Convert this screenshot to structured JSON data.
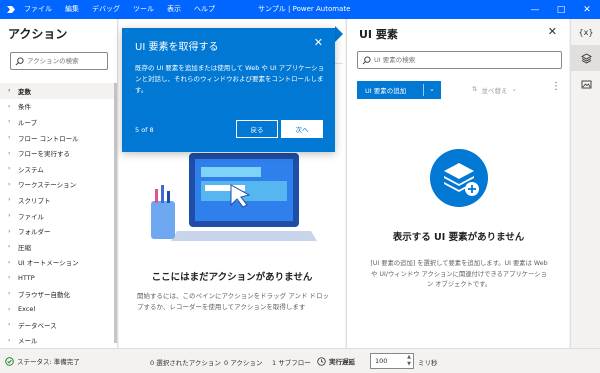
{
  "titlebar": {
    "menu": [
      "ファイル",
      "編集",
      "デバッグ",
      "ツール",
      "表示",
      "ヘルプ"
    ],
    "title": "サンプル | Power Automate",
    "accent": "#0066ff"
  },
  "actions": {
    "title": "アクション",
    "search_placeholder": "アクションの検索",
    "items": [
      "変数",
      "条件",
      "ループ",
      "フロー コントロール",
      "フローを実行する",
      "システム",
      "ワークステーション",
      "スクリプト",
      "ファイル",
      "フォルダー",
      "圧縮",
      "UI オートメーション",
      "HTTP",
      "ブラウザー自動化",
      "Excel",
      "データベース",
      "メール"
    ]
  },
  "center": {
    "empty_title": "ここにはまだアクションがありません",
    "empty_desc": "開始するには、このペインにアクションをドラッグ アンド ドロップするか、レコーダーを使用してアクションを取得します"
  },
  "callout": {
    "title": "UI 要素を取得する",
    "body": "既存の UI 要素を追加または使用して Web や UI アプリケーションと対話し、それらのウィンドウおよび要素をコントロールします。",
    "page": "5 of 8",
    "back_label": "戻る",
    "next_label": "次へ",
    "color": "#0078d4"
  },
  "ui_panel": {
    "title": "UI 要素",
    "search_placeholder": "UI 要素の検索",
    "add_label": "UI 要素の追加",
    "sort_label": "並べ替え",
    "empty_title": "表示する UI 要素がありません",
    "empty_desc": "[UI 要素の追加] を選択して要素を追加します。UI 要素は Web や UI/ウィンドウ アクションに関連付けできるアプリケーション オブジェクトです。"
  },
  "right_strip": {
    "items": [
      "variables-icon",
      "ui-elements-icon",
      "images-icon"
    ],
    "variables_label": "{x}"
  },
  "status": {
    "state": "ステータス: 準備完了",
    "selected": "0 選択されたアクション",
    "actions": "0 アクション",
    "subflows": "1 サブフロー",
    "delay_label": "実行遅延",
    "delay_value": "100",
    "unit": "ミリ秒"
  }
}
